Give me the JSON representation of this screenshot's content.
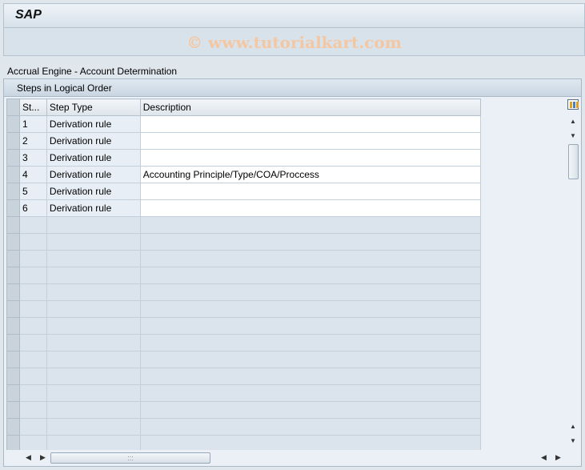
{
  "window": {
    "title": "SAP"
  },
  "watermark": "© www.tutorialkart.com",
  "screen": {
    "subtitle": "Accrual Engine - Account Determination"
  },
  "panel": {
    "title": "Steps in Logical Order",
    "columns": [
      "St...",
      "Step Type",
      "Description"
    ],
    "rows": [
      {
        "step": "1",
        "type": "Derivation rule",
        "description": ""
      },
      {
        "step": "2",
        "type": "Derivation rule",
        "description": ""
      },
      {
        "step": "3",
        "type": "Derivation rule",
        "description": ""
      },
      {
        "step": "4",
        "type": "Derivation rule",
        "description": "Accounting Principle/Type/COA/Proccess"
      },
      {
        "step": "5",
        "type": "Derivation rule",
        "description": ""
      },
      {
        "step": "6",
        "type": "Derivation rule",
        "description": ""
      }
    ]
  },
  "icons": {
    "column_config": "column-configuration-icon",
    "scroll_up": "arrow-up-icon",
    "scroll_down": "arrow-down-icon",
    "scroll_left": "arrow-left-icon",
    "scroll_right": "arrow-right-icon"
  }
}
